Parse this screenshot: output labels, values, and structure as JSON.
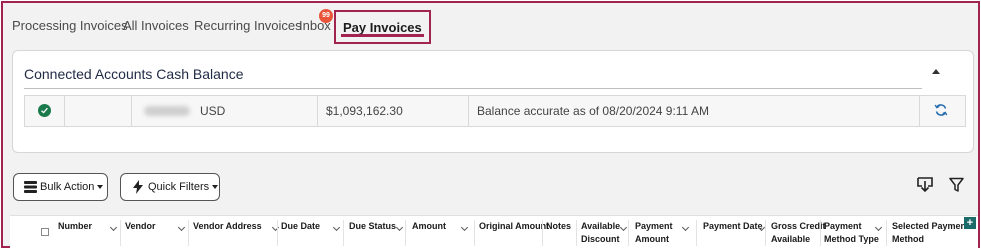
{
  "tabs": [
    {
      "label": "Processing Invoices"
    },
    {
      "label": "All Invoices"
    },
    {
      "label": "Recurring Invoices"
    },
    {
      "label": "Inbox",
      "badge": "99"
    },
    {
      "label": "Pay Invoices",
      "active": true
    }
  ],
  "cash_balance": {
    "title": "Connected Accounts Cash Balance",
    "row": {
      "status_icon": "check-circle-icon",
      "currency": "USD",
      "amount": "$1,093,162.30",
      "note": "Balance accurate as of 08/20/2024 9:11 AM",
      "action_icon": "refresh-icon"
    }
  },
  "toolbar": {
    "bulk_action_label": "Bulk Action",
    "quick_filters_label": "Quick Filters",
    "download_icon": "download-icon",
    "filter_icon": "filter-icon"
  },
  "table": {
    "columns": [
      {
        "line1": "Number",
        "line2": ""
      },
      {
        "line1": "Vendor",
        "line2": ""
      },
      {
        "line1": "Vendor Address",
        "line2": ""
      },
      {
        "line1": "Due Date",
        "line2": ""
      },
      {
        "line1": "Due Status",
        "line2": ""
      },
      {
        "line1": "Amount",
        "line2": ""
      },
      {
        "line1": "Original Amount",
        "line2": ""
      },
      {
        "line1": "Notes",
        "line2": ""
      },
      {
        "line1": "Available",
        "line2": "Discount"
      },
      {
        "line1": "Payment",
        "line2": "Amount"
      },
      {
        "line1": "Payment Date",
        "line2": ""
      },
      {
        "line1": "Gross Credit",
        "line2": "Available"
      },
      {
        "line1": "Payment",
        "line2": "Method Type"
      },
      {
        "line1": "Selected Payment",
        "line2": "Method"
      }
    ],
    "add_column_label": "+"
  },
  "colors": {
    "accent": "#a1234f",
    "badge": "#e8553a",
    "success": "#1a7a4c",
    "teal": "#1c6b6b"
  }
}
